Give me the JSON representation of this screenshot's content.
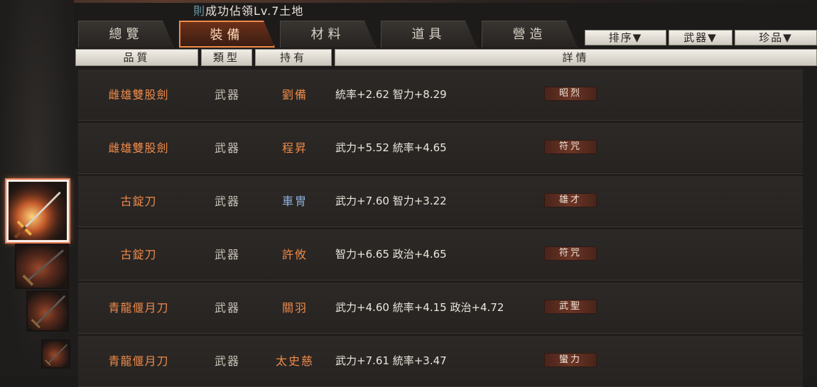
{
  "notice": {
    "mark": "則",
    "text": "成功佔領Lv.7土地"
  },
  "tabs": [
    {
      "label": "總覽",
      "active": false
    },
    {
      "label": "裝備",
      "active": true
    },
    {
      "label": "材料",
      "active": false
    },
    {
      "label": "道具",
      "active": false
    },
    {
      "label": "營造",
      "active": false
    }
  ],
  "filters": [
    {
      "label": "排序▼"
    },
    {
      "label": "武器▼"
    },
    {
      "label": "珍品▼"
    }
  ],
  "columns": {
    "quality": "品質",
    "type": "類型",
    "owner": "持有",
    "details": "詳情"
  },
  "rows": [
    {
      "name": "雌雄雙股劍",
      "type": "武器",
      "owner": "劉備",
      "stats": "統率+2.62  智力+8.29",
      "skill": "昭烈"
    },
    {
      "name": "雌雄雙股劍",
      "type": "武器",
      "owner": "程昇",
      "stats": "武力+5.52  統率+4.65",
      "skill": "符咒"
    },
    {
      "name": "古錠刀",
      "type": "武器",
      "owner": "車冑",
      "stats": "武力+7.60  智力+3.22",
      "skill": "雄才"
    },
    {
      "name": "古錠刀",
      "type": "武器",
      "owner": "許攸",
      "stats": "智力+6.65  政治+4.65",
      "skill": "符咒"
    },
    {
      "name": "青龍偃月刀",
      "type": "武器",
      "owner": "關羽",
      "stats": "武力+4.60  統率+4.15  政治+4.72",
      "skill": "武聖"
    },
    {
      "name": "青龍偃月刀",
      "type": "武器",
      "owner": "太史慈",
      "stats": "武力+7.61  統率+3.47",
      "skill": "蠻力"
    }
  ],
  "colors": {
    "accent": "#f08a4a",
    "owner_blue": "#8fb2e0",
    "badge": "#6b3526"
  },
  "icons": [
    "sword-icon",
    "dropdown-arrow-icon"
  ]
}
